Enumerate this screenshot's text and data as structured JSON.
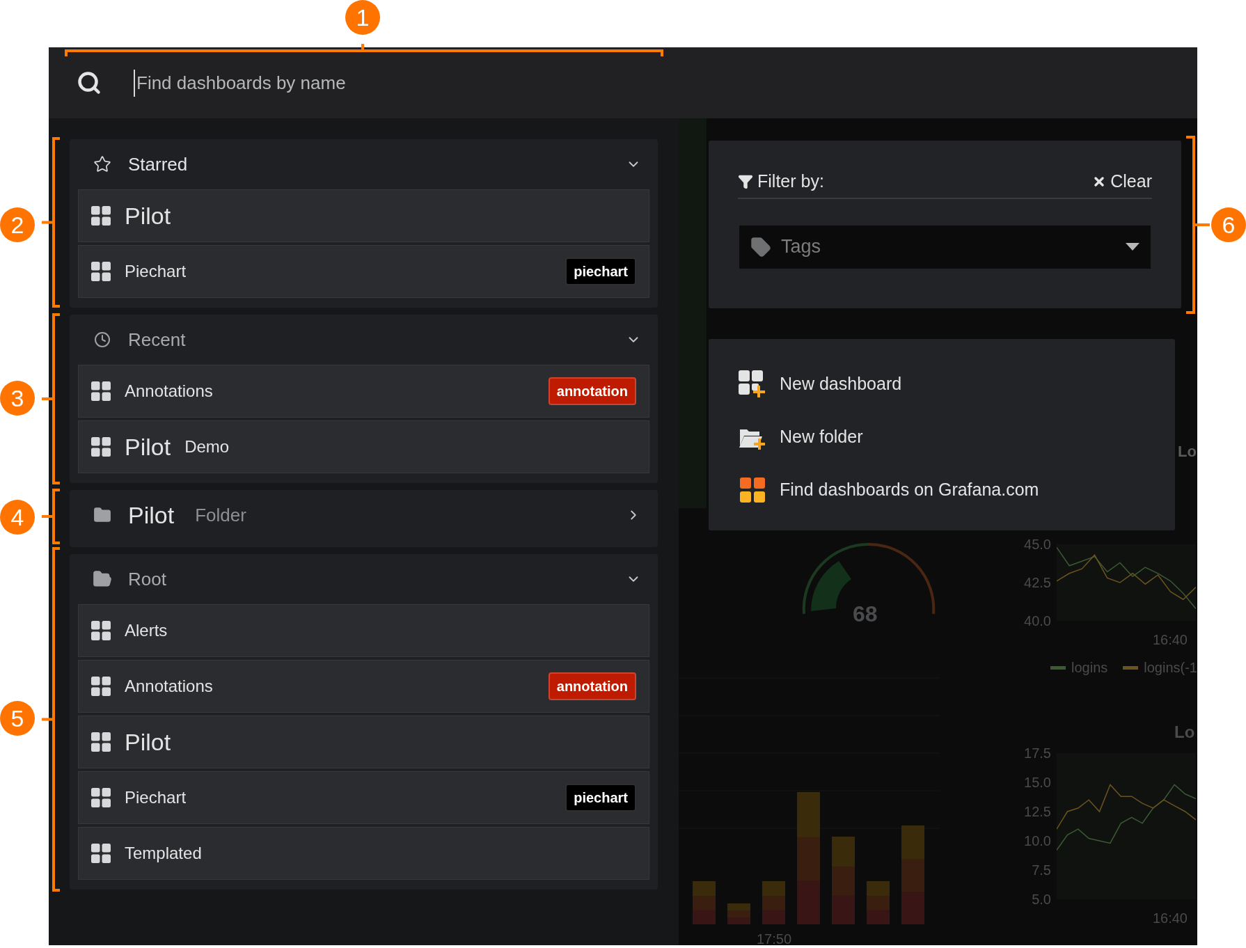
{
  "search": {
    "placeholder": "Find dashboards by name"
  },
  "sections": [
    {
      "kind": "starred",
      "title": "Starred",
      "expanded": true,
      "items": [
        {
          "title": "Pilot",
          "large": true
        },
        {
          "title": "Piechart",
          "large": false,
          "tag": {
            "label": "piechart",
            "color": "#000000"
          }
        }
      ]
    },
    {
      "kind": "recent",
      "title": "Recent",
      "expanded": true,
      "items": [
        {
          "title": "Annotations",
          "large": false,
          "tag": {
            "label": "annotation",
            "color": "#bf1b00"
          }
        },
        {
          "title": "Pilot",
          "subtitle": "Demo",
          "large": true
        }
      ]
    },
    {
      "kind": "folder",
      "title": "Pilot",
      "subtitle": "Folder",
      "large": true,
      "expanded": false
    },
    {
      "kind": "root",
      "title": "Root",
      "expanded": true,
      "items": [
        {
          "title": "Alerts",
          "large": false
        },
        {
          "title": "Annotations",
          "large": false,
          "tag": {
            "label": "annotation",
            "color": "#bf1b00"
          }
        },
        {
          "title": "Pilot",
          "large": true
        },
        {
          "title": "Piechart",
          "large": false,
          "tag": {
            "label": "piechart",
            "color": "#000000"
          }
        },
        {
          "title": "Templated",
          "large": false
        }
      ]
    }
  ],
  "filter": {
    "label": "Filter by:",
    "clear": "Clear",
    "tags_placeholder": "Tags"
  },
  "actions": [
    {
      "kind": "dashboard",
      "label": "New dashboard"
    },
    {
      "kind": "folder",
      "label": "New folder"
    },
    {
      "kind": "grafana",
      "label": "Find dashboards on Grafana.com"
    }
  ],
  "backdrop": {
    "side_title": "Lo",
    "gauge": {
      "value": "68"
    },
    "logins_chart": {
      "chart_data": {
        "type": "line",
        "ylim": [
          40,
          45
        ],
        "yticks": [
          {
            "value": 45,
            "label": "45.0"
          },
          {
            "value": 42.5,
            "label": "42.5"
          },
          {
            "value": 40,
            "label": "40.0"
          }
        ],
        "annotations": [
          "16:40"
        ],
        "legend": "bottom",
        "series": [
          {
            "name": "logins",
            "color": "#3b5a33",
            "values": [
              44.8,
              43.6,
              43.9,
              44.2,
              43.2,
              43.8,
              42.9,
              43.5,
              43.1,
              42.6,
              41.8,
              40.8
            ]
          },
          {
            "name": "logins(-1",
            "color": "#6b5420",
            "values": [
              42.6,
              43.1,
              43.4,
              44.3,
              42.8,
              42.5,
              43.1,
              42.4,
              43.0,
              41.9,
              41.4,
              42.2
            ]
          }
        ]
      }
    },
    "bar_chart": {
      "xtick": "17:50"
    },
    "logouts_chart": {
      "title": "Lo",
      "chart_data": {
        "type": "line",
        "ylim": [
          5,
          17.5
        ],
        "yticks": [
          {
            "value": 17.5,
            "label": "17.5"
          },
          {
            "value": 15,
            "label": "15.0"
          },
          {
            "value": 12.5,
            "label": "12.5"
          },
          {
            "value": 10,
            "label": "10.0"
          },
          {
            "value": 7.5,
            "label": "7.5"
          },
          {
            "value": 5,
            "label": "5.0"
          }
        ],
        "annotations": [
          "16:40"
        ],
        "series": [
          {
            "color": "#3b5a33",
            "values": [
              9.2,
              10.5,
              11.0,
              10.2,
              10.0,
              9.8,
              11.5,
              12.0,
              11.5,
              12.8,
              13.5,
              14.8,
              14.0,
              13.6
            ]
          },
          {
            "color": "#6b5420",
            "values": [
              11.0,
              12.5,
              12.8,
              13.5,
              12.5,
              14.8,
              13.8,
              13.8,
              13.2,
              12.8,
              13.5,
              13.0,
              12.5,
              11.8
            ]
          }
        ]
      }
    }
  },
  "callouts": [
    {
      "number": "1"
    },
    {
      "number": "2"
    },
    {
      "number": "3"
    },
    {
      "number": "4"
    },
    {
      "number": "5"
    },
    {
      "number": "6"
    }
  ]
}
